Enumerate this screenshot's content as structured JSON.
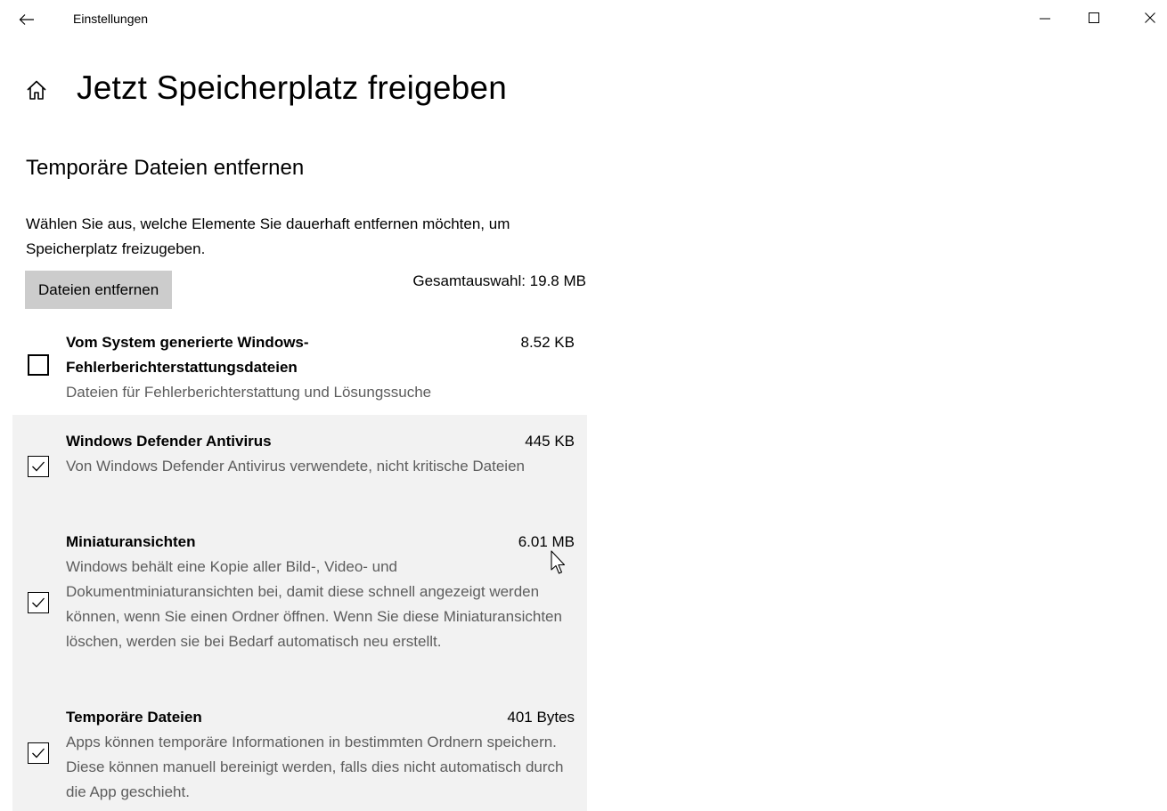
{
  "titlebar": {
    "title": "Einstellungen",
    "back_icon": "arrow-left-icon",
    "minimize_icon": "minimize-icon",
    "maximize_icon": "maximize-icon",
    "close_icon": "close-icon"
  },
  "page": {
    "home_icon": "home-icon",
    "title": "Jetzt Speicherplatz freigeben"
  },
  "section": {
    "title": "Temporäre Dateien entfernen",
    "description": "Wählen Sie aus, welche Elemente Sie dauerhaft entfernen möchten, um Speicherplatz freizugeben.",
    "remove_button_label": "Dateien entfernen",
    "total_selection": "Gesamtauswahl: 19.8 MB"
  },
  "items": [
    {
      "title": "Vom System generierte Windows-Fehlerberichterstattungsdateien",
      "size": "8.52 KB",
      "description": "Dateien für Fehlerberichterstattung und Lösungssuche",
      "checked": false
    },
    {
      "title": "Windows Defender Antivirus",
      "size": "445 KB",
      "description": "Von Windows Defender Antivirus verwendete, nicht kritische Dateien",
      "checked": true
    },
    {
      "title": "Miniaturansichten",
      "size": "6.01 MB",
      "description": "Windows behält eine Kopie aller Bild-, Video- und Dokumentminiaturansichten bei, damit diese schnell angezeigt werden können, wenn Sie einen Ordner öffnen. Wenn Sie diese Miniaturansichten löschen, werden sie bei Bedarf automatisch neu erstellt.",
      "checked": true
    },
    {
      "title": "Temporäre Dateien",
      "size": "401 Bytes",
      "description": "Apps können temporäre Informationen in bestimmten Ordnern speichern. Diese können manuell bereinigt werden, falls dies nicht automatisch durch die App geschieht.",
      "checked": true
    }
  ],
  "colors": {
    "selected_row_bg": "#f2f2f2",
    "button_bg": "#cccccc",
    "secondary_text": "#5d5d5d"
  }
}
